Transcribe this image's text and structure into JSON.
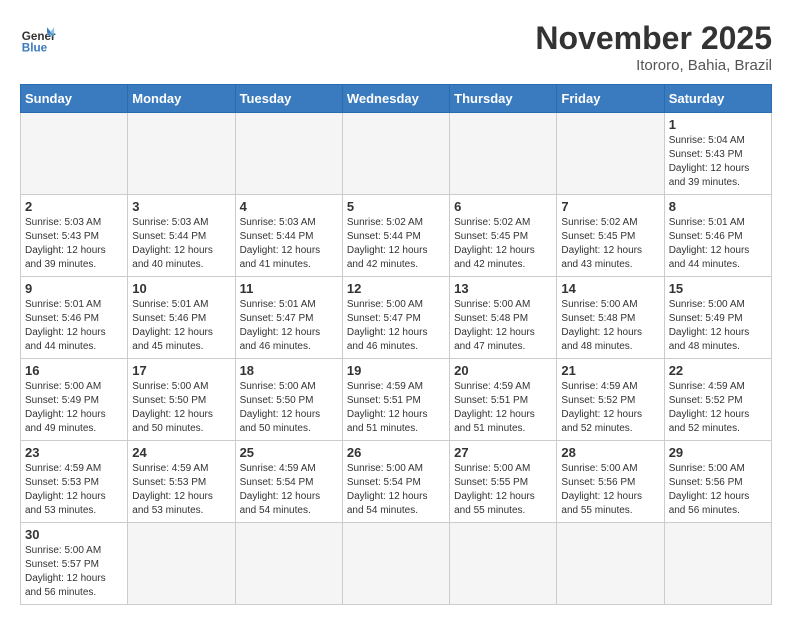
{
  "header": {
    "logo_general": "General",
    "logo_blue": "Blue",
    "month_title": "November 2025",
    "location": "Itororo, Bahia, Brazil"
  },
  "days_of_week": [
    "Sunday",
    "Monday",
    "Tuesday",
    "Wednesday",
    "Thursday",
    "Friday",
    "Saturday"
  ],
  "weeks": [
    [
      {
        "day": "",
        "empty": true
      },
      {
        "day": "",
        "empty": true
      },
      {
        "day": "",
        "empty": true
      },
      {
        "day": "",
        "empty": true
      },
      {
        "day": "",
        "empty": true
      },
      {
        "day": "",
        "empty": true
      },
      {
        "day": "1",
        "sunrise": "Sunrise: 5:04 AM",
        "sunset": "Sunset: 5:43 PM",
        "daylight": "Daylight: 12 hours and 39 minutes."
      }
    ],
    [
      {
        "day": "2",
        "sunrise": "Sunrise: 5:03 AM",
        "sunset": "Sunset: 5:43 PM",
        "daylight": "Daylight: 12 hours and 39 minutes."
      },
      {
        "day": "3",
        "sunrise": "Sunrise: 5:03 AM",
        "sunset": "Sunset: 5:44 PM",
        "daylight": "Daylight: 12 hours and 40 minutes."
      },
      {
        "day": "4",
        "sunrise": "Sunrise: 5:03 AM",
        "sunset": "Sunset: 5:44 PM",
        "daylight": "Daylight: 12 hours and 41 minutes."
      },
      {
        "day": "5",
        "sunrise": "Sunrise: 5:02 AM",
        "sunset": "Sunset: 5:44 PM",
        "daylight": "Daylight: 12 hours and 42 minutes."
      },
      {
        "day": "6",
        "sunrise": "Sunrise: 5:02 AM",
        "sunset": "Sunset: 5:45 PM",
        "daylight": "Daylight: 12 hours and 42 minutes."
      },
      {
        "day": "7",
        "sunrise": "Sunrise: 5:02 AM",
        "sunset": "Sunset: 5:45 PM",
        "daylight": "Daylight: 12 hours and 43 minutes."
      },
      {
        "day": "8",
        "sunrise": "Sunrise: 5:01 AM",
        "sunset": "Sunset: 5:46 PM",
        "daylight": "Daylight: 12 hours and 44 minutes."
      }
    ],
    [
      {
        "day": "9",
        "sunrise": "Sunrise: 5:01 AM",
        "sunset": "Sunset: 5:46 PM",
        "daylight": "Daylight: 12 hours and 44 minutes."
      },
      {
        "day": "10",
        "sunrise": "Sunrise: 5:01 AM",
        "sunset": "Sunset: 5:46 PM",
        "daylight": "Daylight: 12 hours and 45 minutes."
      },
      {
        "day": "11",
        "sunrise": "Sunrise: 5:01 AM",
        "sunset": "Sunset: 5:47 PM",
        "daylight": "Daylight: 12 hours and 46 minutes."
      },
      {
        "day": "12",
        "sunrise": "Sunrise: 5:00 AM",
        "sunset": "Sunset: 5:47 PM",
        "daylight": "Daylight: 12 hours and 46 minutes."
      },
      {
        "day": "13",
        "sunrise": "Sunrise: 5:00 AM",
        "sunset": "Sunset: 5:48 PM",
        "daylight": "Daylight: 12 hours and 47 minutes."
      },
      {
        "day": "14",
        "sunrise": "Sunrise: 5:00 AM",
        "sunset": "Sunset: 5:48 PM",
        "daylight": "Daylight: 12 hours and 48 minutes."
      },
      {
        "day": "15",
        "sunrise": "Sunrise: 5:00 AM",
        "sunset": "Sunset: 5:49 PM",
        "daylight": "Daylight: 12 hours and 48 minutes."
      }
    ],
    [
      {
        "day": "16",
        "sunrise": "Sunrise: 5:00 AM",
        "sunset": "Sunset: 5:49 PM",
        "daylight": "Daylight: 12 hours and 49 minutes."
      },
      {
        "day": "17",
        "sunrise": "Sunrise: 5:00 AM",
        "sunset": "Sunset: 5:50 PM",
        "daylight": "Daylight: 12 hours and 50 minutes."
      },
      {
        "day": "18",
        "sunrise": "Sunrise: 5:00 AM",
        "sunset": "Sunset: 5:50 PM",
        "daylight": "Daylight: 12 hours and 50 minutes."
      },
      {
        "day": "19",
        "sunrise": "Sunrise: 4:59 AM",
        "sunset": "Sunset: 5:51 PM",
        "daylight": "Daylight: 12 hours and 51 minutes."
      },
      {
        "day": "20",
        "sunrise": "Sunrise: 4:59 AM",
        "sunset": "Sunset: 5:51 PM",
        "daylight": "Daylight: 12 hours and 51 minutes."
      },
      {
        "day": "21",
        "sunrise": "Sunrise: 4:59 AM",
        "sunset": "Sunset: 5:52 PM",
        "daylight": "Daylight: 12 hours and 52 minutes."
      },
      {
        "day": "22",
        "sunrise": "Sunrise: 4:59 AM",
        "sunset": "Sunset: 5:52 PM",
        "daylight": "Daylight: 12 hours and 52 minutes."
      }
    ],
    [
      {
        "day": "23",
        "sunrise": "Sunrise: 4:59 AM",
        "sunset": "Sunset: 5:53 PM",
        "daylight": "Daylight: 12 hours and 53 minutes."
      },
      {
        "day": "24",
        "sunrise": "Sunrise: 4:59 AM",
        "sunset": "Sunset: 5:53 PM",
        "daylight": "Daylight: 12 hours and 53 minutes."
      },
      {
        "day": "25",
        "sunrise": "Sunrise: 4:59 AM",
        "sunset": "Sunset: 5:54 PM",
        "daylight": "Daylight: 12 hours and 54 minutes."
      },
      {
        "day": "26",
        "sunrise": "Sunrise: 5:00 AM",
        "sunset": "Sunset: 5:54 PM",
        "daylight": "Daylight: 12 hours and 54 minutes."
      },
      {
        "day": "27",
        "sunrise": "Sunrise: 5:00 AM",
        "sunset": "Sunset: 5:55 PM",
        "daylight": "Daylight: 12 hours and 55 minutes."
      },
      {
        "day": "28",
        "sunrise": "Sunrise: 5:00 AM",
        "sunset": "Sunset: 5:56 PM",
        "daylight": "Daylight: 12 hours and 55 minutes."
      },
      {
        "day": "29",
        "sunrise": "Sunrise: 5:00 AM",
        "sunset": "Sunset: 5:56 PM",
        "daylight": "Daylight: 12 hours and 56 minutes."
      }
    ],
    [
      {
        "day": "30",
        "sunrise": "Sunrise: 5:00 AM",
        "sunset": "Sunset: 5:57 PM",
        "daylight": "Daylight: 12 hours and 56 minutes."
      },
      {
        "day": "",
        "empty": true
      },
      {
        "day": "",
        "empty": true
      },
      {
        "day": "",
        "empty": true
      },
      {
        "day": "",
        "empty": true
      },
      {
        "day": "",
        "empty": true
      },
      {
        "day": "",
        "empty": true
      }
    ]
  ]
}
